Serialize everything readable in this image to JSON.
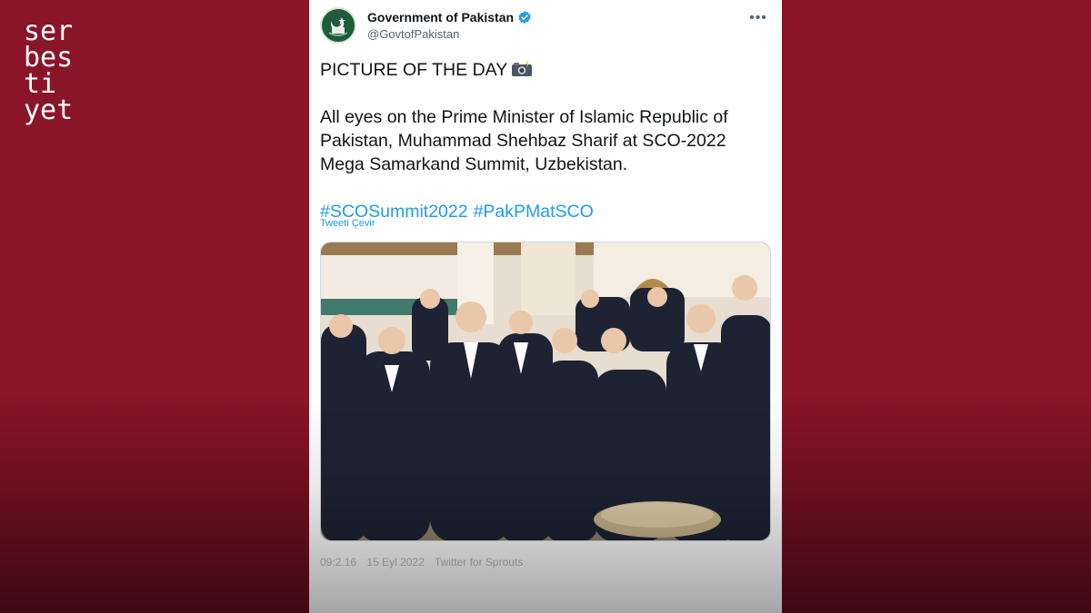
{
  "logo": {
    "lines": [
      "ser",
      "bes",
      "ti",
      "yet"
    ]
  },
  "tweet": {
    "display_name": "Government of Pakistan",
    "handle": "@GovtofPakistan",
    "more_icon": "ellipsis-icon",
    "verified_icon": "verified-badge-icon",
    "line1": "PICTURE OF THE DAY",
    "line1_icon": "camera-flash-icon",
    "body": "All eyes on the Prime Minister of Islamic Republic of Pakistan,  Muhammad Shehbaz Sharif at SCO-2022 Mega Samarkand Summit, Uzbekistan.",
    "hashtags": [
      "#SCOSummit2022",
      "#PakPMatSCO"
    ],
    "translate_label": "Tweeti Çevir",
    "meta_time": "09:2.16",
    "meta_date": "15 Eyl 2022",
    "meta_source": "Twitter for Sprouts"
  },
  "colors": {
    "background": "#8a1428",
    "card": "#ffffff",
    "link": "#1d9bf0",
    "verified": "#1d9bf0",
    "text": "#0f1419",
    "muted": "#536471"
  }
}
